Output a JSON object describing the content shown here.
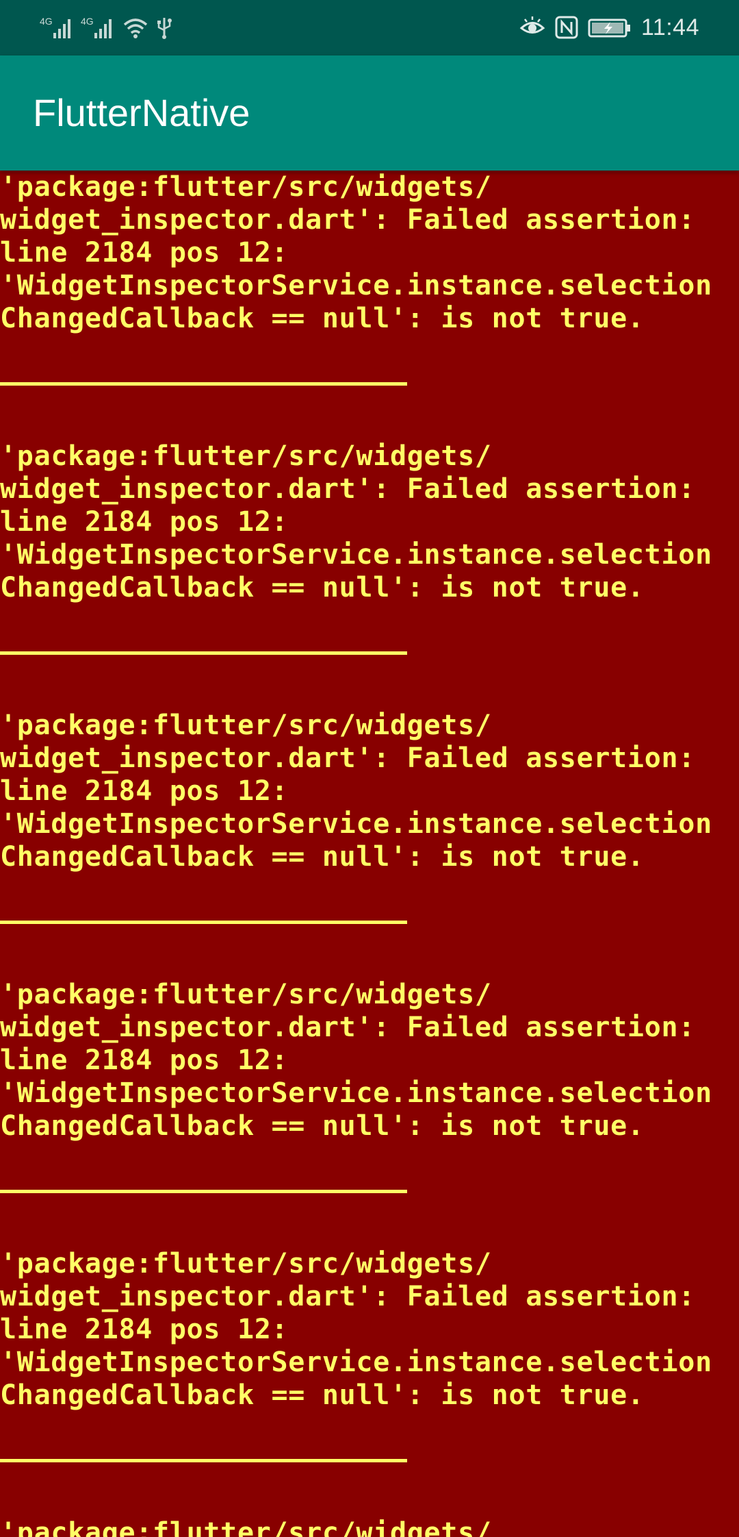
{
  "status_bar": {
    "signal_1": "4G",
    "signal_2": "4G",
    "time": "11:44"
  },
  "app_bar": {
    "title": "FlutterNative"
  },
  "error": {
    "lines": [
      "'package:flutter/src/widgets/",
      "widget_inspector.dart': Failed assertion:",
      "line 2184 pos 12:",
      "'WidgetInspectorService.instance.selection",
      "ChangedCallback == null': is not true."
    ],
    "partial_line": "'package:flutter/src/widgets/"
  },
  "colors": {
    "background": "#880000",
    "error_text": "#ffff66",
    "app_bar": "#00897b",
    "status_bar": "#00574f"
  }
}
